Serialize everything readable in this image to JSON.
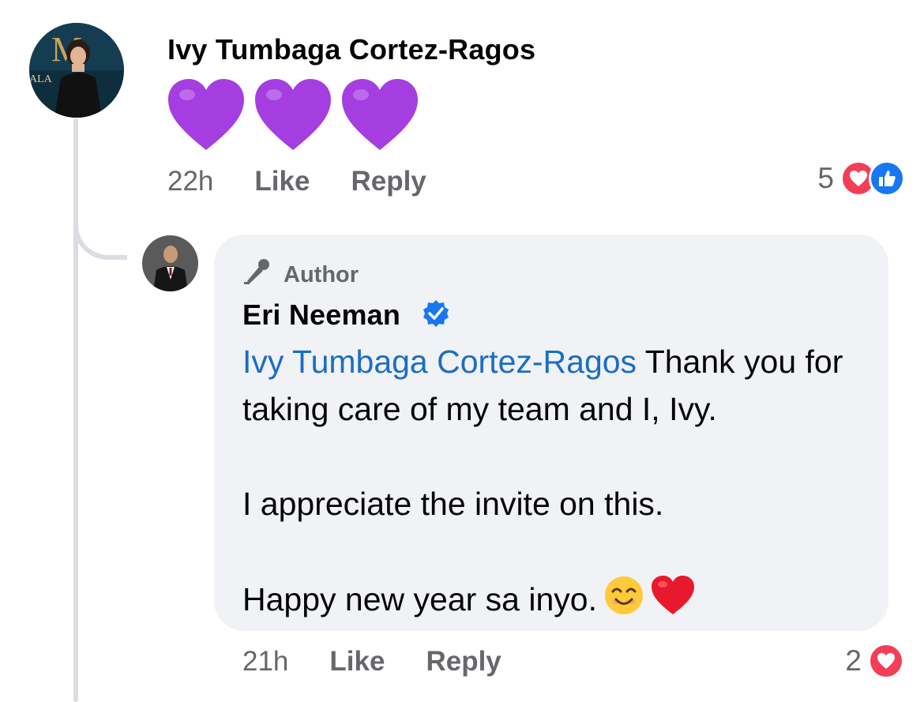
{
  "comment": {
    "author": "Ivy Tumbaga Cortez-Ragos",
    "time": "22h",
    "like_label": "Like",
    "reply_label": "Reply",
    "reaction_count": "5",
    "reactions": [
      "love-icon",
      "like-icon"
    ],
    "content_icons": [
      "purple-heart-icon",
      "purple-heart-icon",
      "purple-heart-icon"
    ]
  },
  "reply": {
    "badge_label": "Author",
    "author": "Eri Neeman",
    "verified": true,
    "mention": "Ivy Tumbaga Cortez-Ragos",
    "line1_rest": " Thank you for taking care of my team and I, Ivy.",
    "line2": "I appreciate the invite on this.",
    "line3": "Happy new year sa inyo.",
    "trailing_emojis": [
      "smiling-face-icon",
      "red-heart-icon"
    ],
    "time": "21h",
    "like_label": "Like",
    "reply_label": "Reply",
    "reaction_count": "2",
    "reactions": [
      "love-icon"
    ]
  },
  "colors": {
    "mention": "#1b6ec2",
    "meta_text": "#65676b",
    "bubble": "#f0f2f5",
    "love": "#f33e58",
    "like": "#1877f2",
    "verified": "#1877f2",
    "purple_heart": "#a43ee0"
  }
}
